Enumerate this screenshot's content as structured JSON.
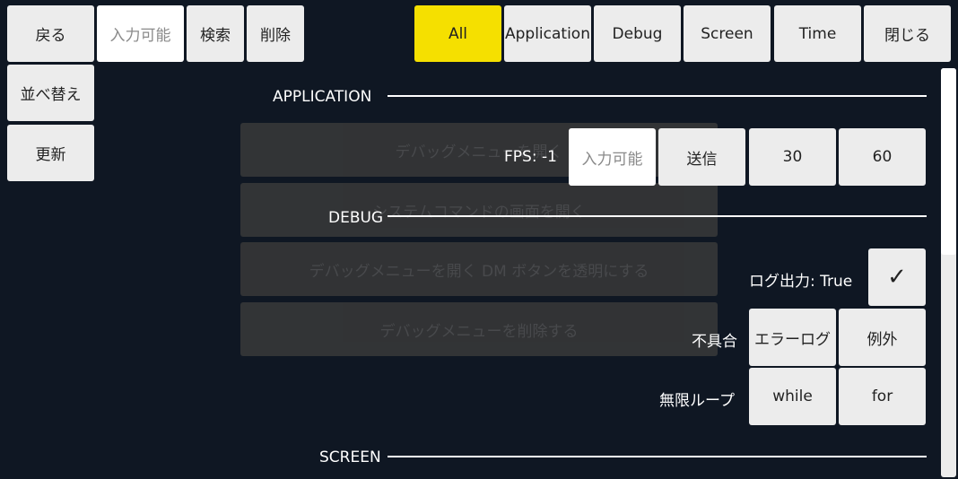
{
  "toolbar": {
    "back_label": "戻る",
    "input_placeholder": "入力可能",
    "search_label": "検索",
    "delete_label": "削除",
    "sort_label": "並べ替え",
    "refresh_label": "更新"
  },
  "filters": {
    "all": "All",
    "application": "Application",
    "debug": "Debug",
    "screen": "Screen",
    "time": "Time",
    "close": "閉じる",
    "active": "All",
    "active_color": "#f5e000"
  },
  "sections": {
    "application": "APPLICATION",
    "debug": "DEBUG",
    "screen": "SCREEN"
  },
  "menu_items": [
    "デバッグメニューを開く",
    "システムコマンドの画面を開く",
    "デバッグメニューを開く DM ボタンを透明にする",
    "デバッグメニューを削除する"
  ],
  "fps": {
    "label": "FPS: -1",
    "input_placeholder": "入力可能",
    "send_label": "送信",
    "option_30": "30",
    "option_60": "60"
  },
  "log_output": {
    "label": "ログ出力: True",
    "checked": true,
    "check_glyph": "✓"
  },
  "defect": {
    "label": "不具合",
    "error_log": "エラーログ",
    "exception": "例外"
  },
  "infinite_loop": {
    "label": "無限ループ",
    "while": "while",
    "for": "for"
  },
  "scrollbar": {
    "position_fraction": 0.0,
    "visible_fraction": 0.45
  }
}
